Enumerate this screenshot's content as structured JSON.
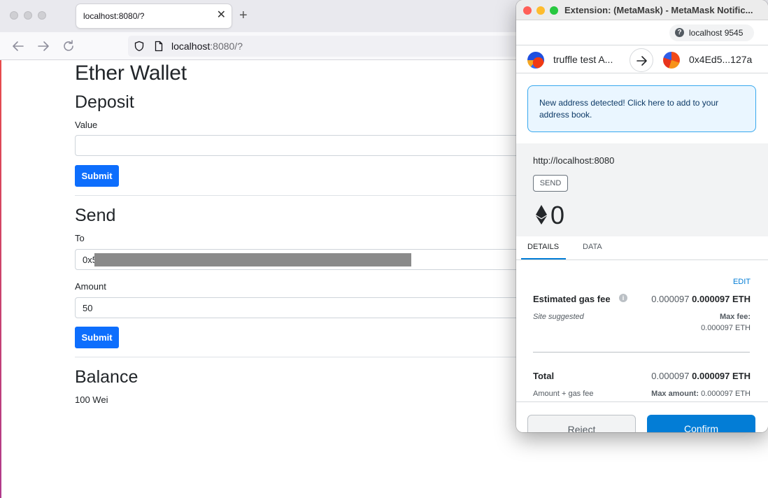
{
  "browser": {
    "tab_title": "localhost:8080/?",
    "tab_close": "✕",
    "new_tab": "+",
    "url_host": "localhost",
    "url_rest": ":8080/?"
  },
  "page": {
    "title": "Ether Wallet",
    "deposit": {
      "heading": "Deposit",
      "value_label": "Value",
      "value_input": "",
      "submit_label": "Submit"
    },
    "send": {
      "heading": "Send",
      "to_label": "To",
      "to_value": "0x5",
      "amount_label": "Amount",
      "amount_value": "50",
      "submit_label": "Submit"
    },
    "balance": {
      "heading": "Balance",
      "value": "100 Wei"
    }
  },
  "metamask": {
    "window_title": "Extension: (MetaMask) - MetaMask Notific...",
    "network": "localhost 9545",
    "network_icon": "?",
    "from_account": "truffle test A...",
    "to_account": "0x4Ed5...127a",
    "notice": "New address detected! Click here to add to your address book.",
    "origin": "http://localhost:8080",
    "action_badge": "SEND",
    "amount": "0",
    "tabs": [
      "DETAILS",
      "DATA"
    ],
    "edit_label": "EDIT",
    "gas_fee": {
      "label": "Estimated gas fee",
      "value_plain": "0.000097",
      "value_bold": "0.000097 ETH",
      "sub_left": "Site suggested",
      "max_label": "Max fee:",
      "max_value": "0.000097 ETH"
    },
    "total": {
      "label": "Total",
      "value_plain": "0.000097",
      "value_bold": "0.000097 ETH",
      "sub_left": "Amount + gas fee",
      "max_label": "Max amount:",
      "max_value": "0.000097 ETH"
    },
    "reject_label": "Reject",
    "confirm_label": "Confirm"
  }
}
